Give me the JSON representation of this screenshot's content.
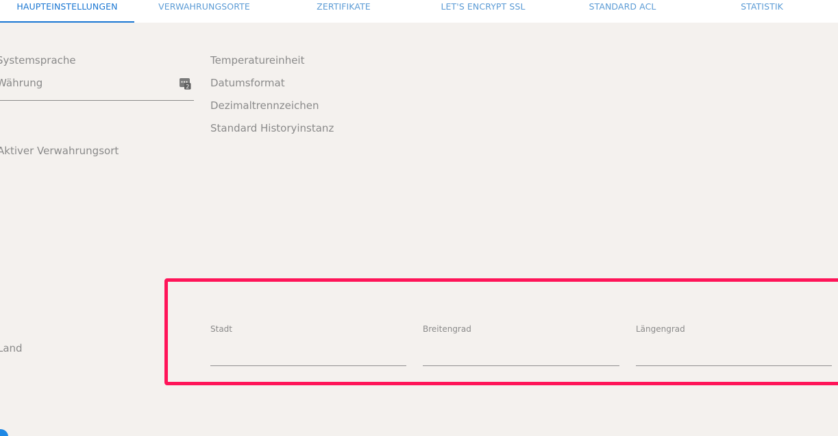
{
  "tabs": [
    {
      "label": "HAUPTEINSTELLUNGEN",
      "active": true
    },
    {
      "label": "VERWAHRUNGSORTE"
    },
    {
      "label": "ZERTIFIKATE"
    },
    {
      "label": "LET'S ENCRYPT SSL"
    },
    {
      "label": "STANDARD ACL"
    },
    {
      "label": "STATISTIK"
    }
  ],
  "left": {
    "systemsprache": "Systemsprache",
    "waehrung": "Währung",
    "aktiver_verwahrungsort": "Aktiver Verwahrungsort",
    "land": "Land"
  },
  "right": {
    "temperatureinheit": "Temperatureinheit",
    "datumsformat": "Datumsformat",
    "dezimaltrennzeichen": "Dezimaltrennzeichen",
    "standard_historyinstanz": "Standard Historyinstanz"
  },
  "location": {
    "stadt_label": "Stadt",
    "breitengrad_label": "Breitengrad",
    "laengengrad_label": "Längengrad",
    "stadt_value": "",
    "breitengrad_value": "",
    "laengengrad_value": ""
  },
  "icons": {
    "currency": "calculator-icon"
  },
  "colors": {
    "accent": "#1976d2",
    "tab_text": "#5b9bd5",
    "highlight": "#ff1458",
    "background": "#f4f1ee"
  }
}
